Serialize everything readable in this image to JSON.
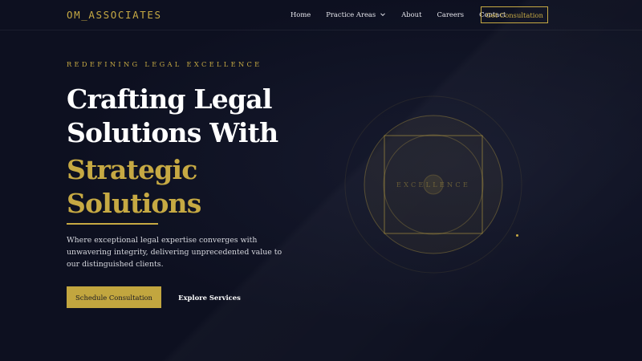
{
  "brand": {
    "logo_text": "OM_ASSOCIATES"
  },
  "nav": {
    "items": [
      {
        "label": "Home"
      },
      {
        "label": "Practice Areas",
        "has_dropdown": true
      },
      {
        "label": "About"
      },
      {
        "label": "Careers"
      },
      {
        "label": "Contact"
      }
    ],
    "cta_label": "Get Consultation"
  },
  "hero": {
    "eyebrow": "REDEFINING LEGAL EXCELLENCE",
    "headline_lines": [
      "Crafting Legal",
      "Solutions With"
    ],
    "headline_accent_lines": [
      "Strategic",
      "Solutions"
    ],
    "subcopy": "Where exceptional legal expertise converges with unwavering integrity, delivering unprecedented value to our distinguished clients.",
    "primary_button": "Schedule Consultation",
    "secondary_button": "Explore Services"
  },
  "emblem": {
    "label": "EXCELLENCE"
  },
  "colors": {
    "background": "#0d1020",
    "accent_gold": "#c6a943",
    "text_primary": "#ffffff",
    "text_muted": "#d6d7de"
  },
  "icons": {
    "dropdown": "chevron-down-icon"
  }
}
